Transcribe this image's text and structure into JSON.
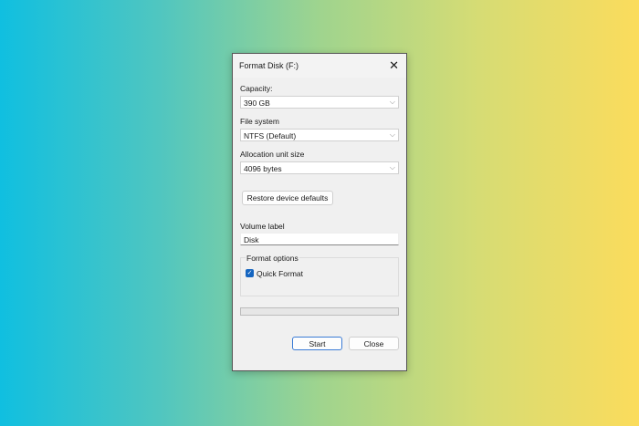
{
  "dialog": {
    "title": "Format Disk (F:)",
    "capacity": {
      "label": "Capacity:",
      "value": "390 GB"
    },
    "file_system": {
      "label": "File system",
      "value": "NTFS (Default)"
    },
    "allocation": {
      "label": "Allocation unit size",
      "value": "4096 bytes"
    },
    "restore_label": "Restore device defaults",
    "volume": {
      "label": "Volume label",
      "value": "Disk"
    },
    "format_options": {
      "label": "Format options",
      "quick_format": "Quick Format",
      "quick_format_checked": true
    },
    "progress": 0,
    "start_label": "Start",
    "close_label": "Close"
  },
  "colors": {
    "accent": "#1565c0"
  }
}
